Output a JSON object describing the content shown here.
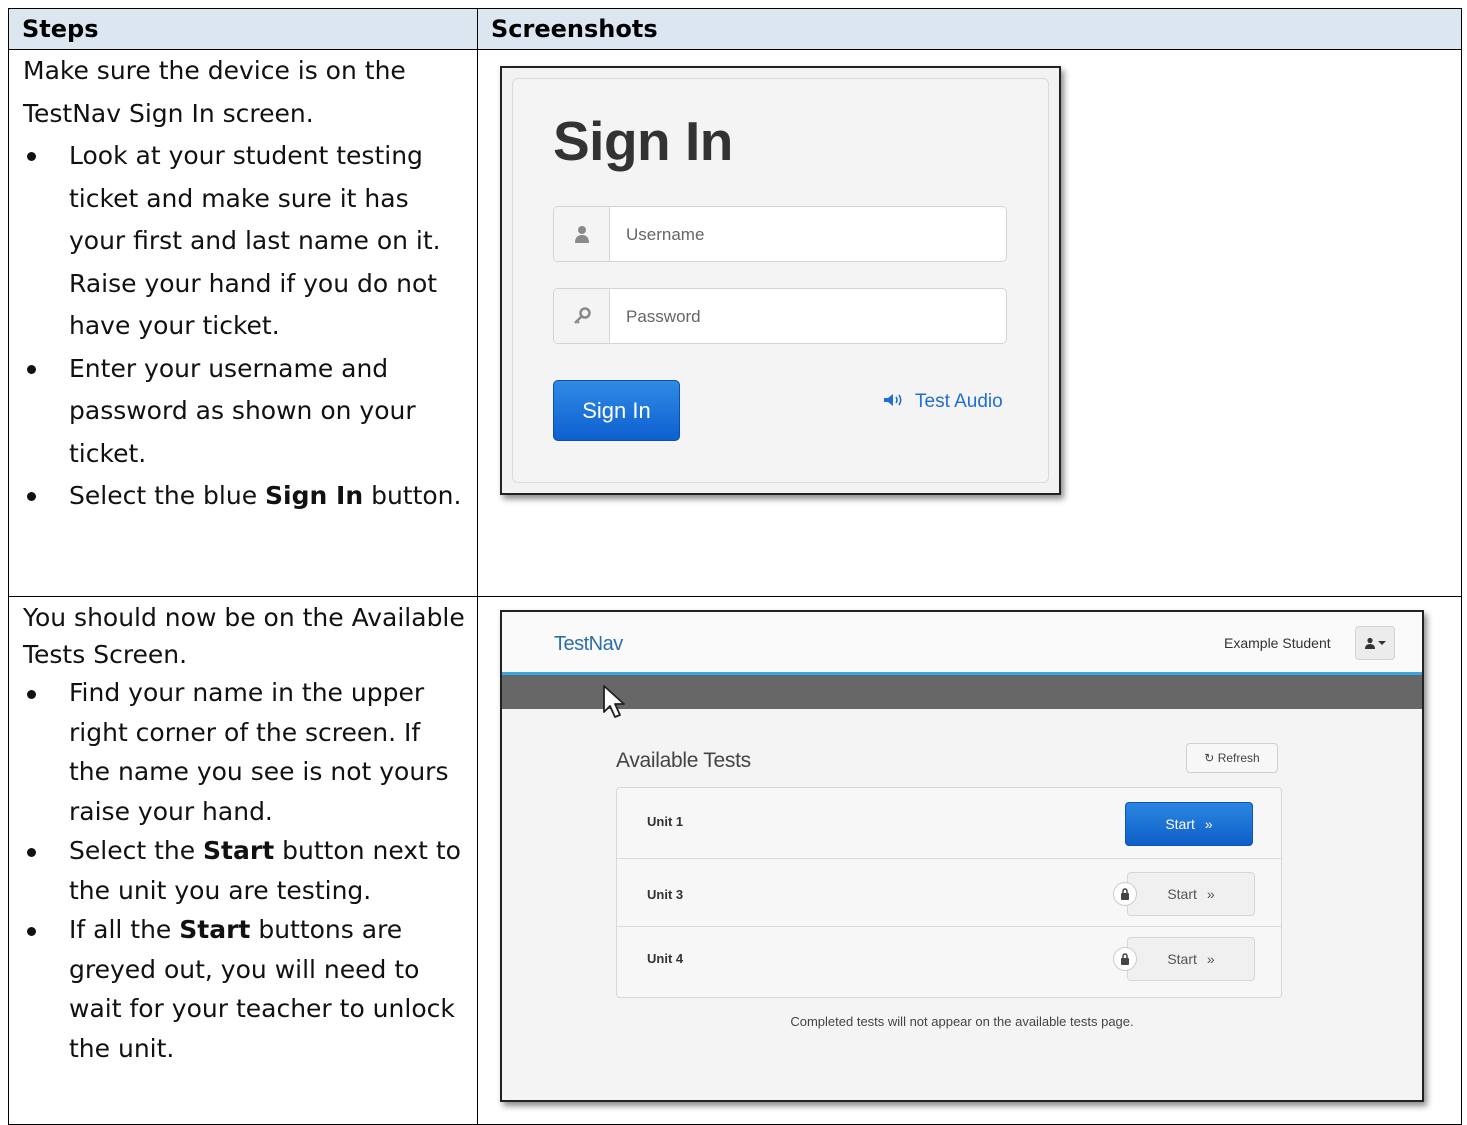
{
  "table": {
    "headers": {
      "steps": "Steps",
      "screenshots": "Screenshots"
    }
  },
  "step1": {
    "intro": "Make sure the device is on the TestNav Sign In screen.",
    "bullets": [
      "Look at your student testing ticket and make sure it has your first and last name on it. Raise your hand if you do not have your ticket.",
      "Enter your username and password as shown on your ticket."
    ],
    "bullet3_pre": "Select the blue ",
    "bullet3_bold": "Sign In",
    "bullet3_post": " button."
  },
  "step2": {
    "intro": "You should now be on the Available Tests Screen.",
    "bullet1": "Find your name in the upper right corner of the screen. If the name you see is not yours raise your hand.",
    "bullet2_pre": "Select the ",
    "bullet2_bold": "Start",
    "bullet2_post": " button next to the unit you are testing.",
    "bullet3_pre": "If all the ",
    "bullet3_bold": "Start",
    "bullet3_post": " buttons are greyed out, you will need to wait for your teacher to unlock the unit."
  },
  "signin_screen": {
    "title": "Sign In",
    "username_placeholder": "Username",
    "password_placeholder": "Password",
    "signin_button": "Sign In",
    "audio_link": "Test Audio",
    "icons": [
      "user-icon",
      "key-icon",
      "speaker-icon"
    ],
    "accent_color": "#1163d4"
  },
  "tests_screen": {
    "logo": "TestNav",
    "student_name": "Example Student",
    "title": "Available Tests",
    "refresh_button": "Refresh",
    "tests": [
      {
        "unit": "Unit 1",
        "button": "Start",
        "locked": false
      },
      {
        "unit": "Unit 3",
        "button": "Start",
        "locked": true
      },
      {
        "unit": "Unit 4",
        "button": "Start",
        "locked": true
      }
    ],
    "note": "Completed tests will not appear on the available tests page.",
    "header_accent": "#3aa6de",
    "start_color": "#1163d4"
  }
}
